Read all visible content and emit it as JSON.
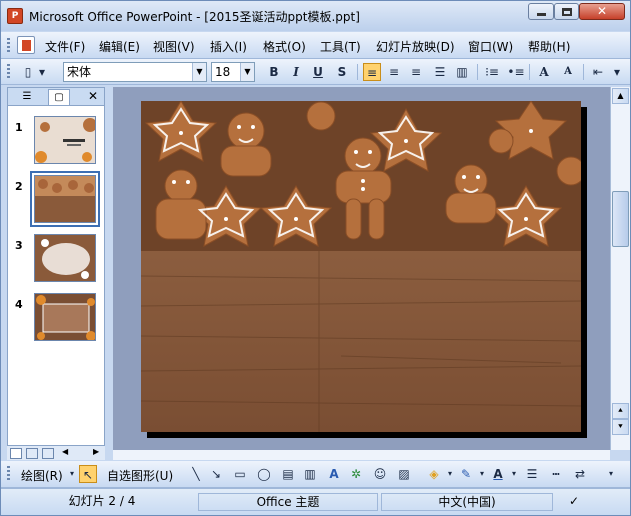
{
  "title": "Microsoft Office PowerPoint - [2015圣诞活动ppt模板.ppt]",
  "window_buttons": {
    "close": "✕"
  },
  "menus": [
    "文件(F)",
    "编辑(E)",
    "视图(V)",
    "插入(I)",
    "格式(O)",
    "工具(T)",
    "幻灯片放映(D)",
    "窗口(W)",
    "帮助(H)"
  ],
  "toolbar": {
    "font_name": "宋体",
    "font_size": "18",
    "bold": "B",
    "italic": "I",
    "underline": "U",
    "shadow": "S",
    "grow_font": "A",
    "shrink_font": "A"
  },
  "pane": {
    "close": "✕"
  },
  "slides": [
    {
      "num": "1"
    },
    {
      "num": "2"
    },
    {
      "num": "3"
    },
    {
      "num": "4"
    }
  ],
  "drawbar": {
    "draw": "绘图(R)",
    "autoshapes": "自选图形(U)"
  },
  "status": {
    "slide": "幻灯片 2 / 4",
    "theme": "Office 主题",
    "lang": "中文(中国)"
  },
  "colors": {
    "accent": "#3c6fb4",
    "wood": "#8a5a3a",
    "cookie": "#b5703d",
    "icing": "#ffffff",
    "active_btn": "#ffd26e"
  }
}
